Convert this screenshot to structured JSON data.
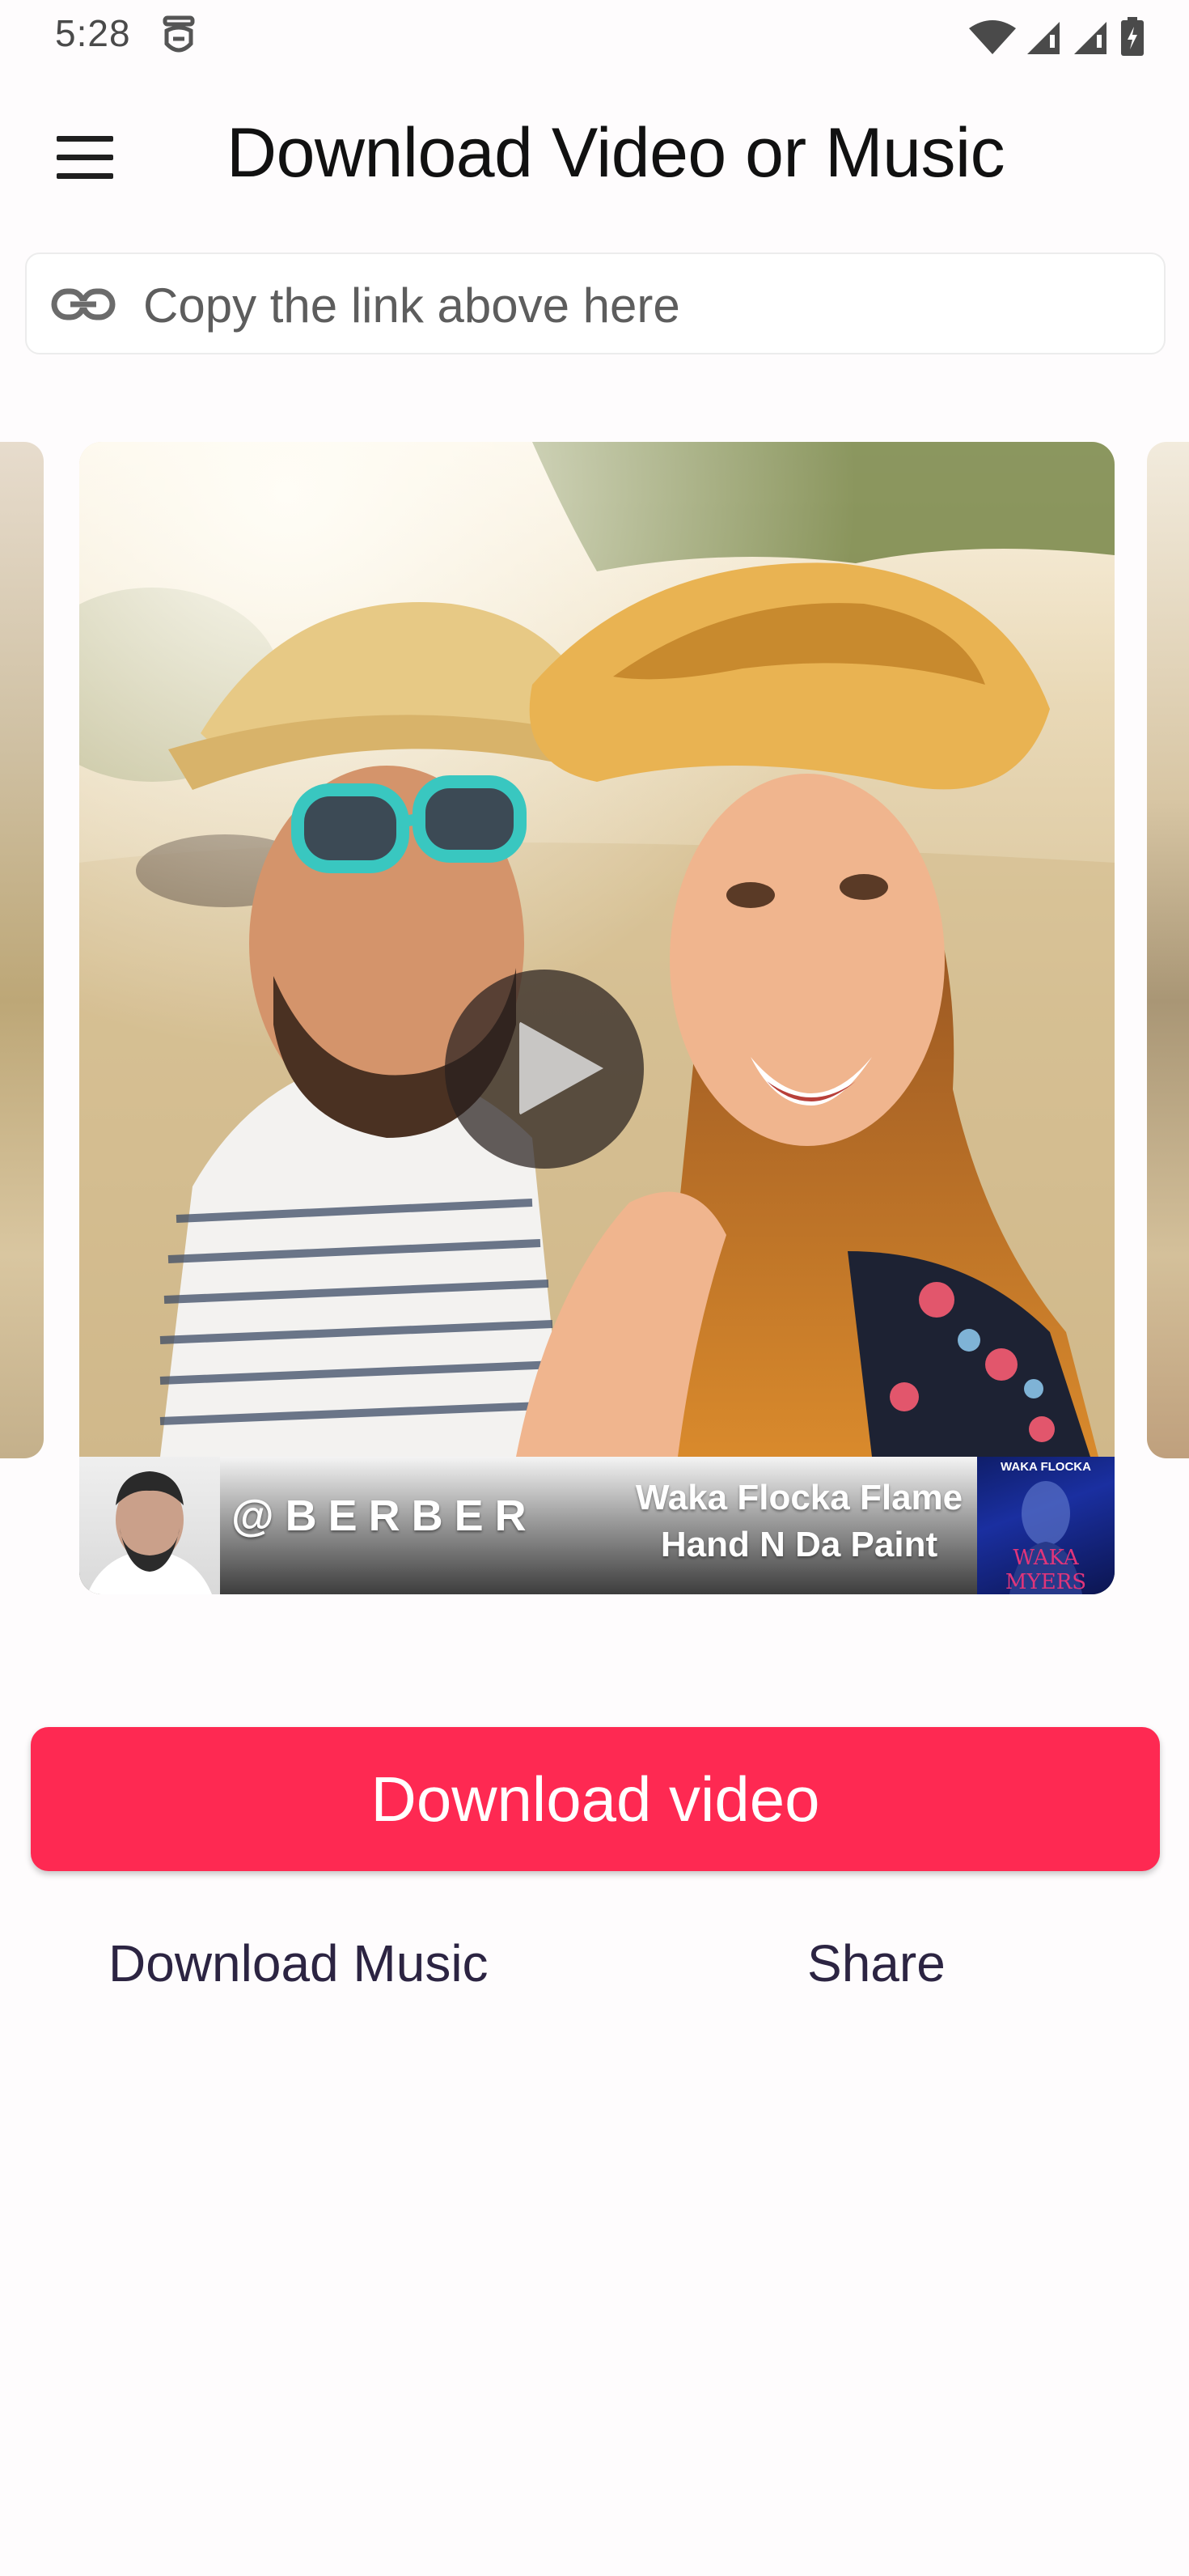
{
  "status_bar": {
    "time": "5:28",
    "icons": [
      "app-notification-icon",
      "wifi-icon",
      "signal-icon",
      "signal-icon",
      "battery-icon"
    ]
  },
  "app_bar": {
    "title": "Download Video or Music",
    "menu_icon": "hamburger-menu-icon"
  },
  "link_field": {
    "icon": "link-icon",
    "placeholder": "Copy the link above here",
    "value": ""
  },
  "video_card": {
    "play_icon": "play-icon",
    "music": {
      "username": "@BERBER",
      "artist": "Waka Flocka Flame",
      "song": "Hand N Da Paint",
      "album_artist": "WAKA FLOCKA",
      "album_title": "WAKA MYERS"
    }
  },
  "actions": {
    "download_video": "Download video",
    "download_music": "Download Music",
    "share": "Share"
  },
  "colors": {
    "accent": "#fe2952",
    "text_button": "#2c2442",
    "background": "#fefcfd"
  }
}
